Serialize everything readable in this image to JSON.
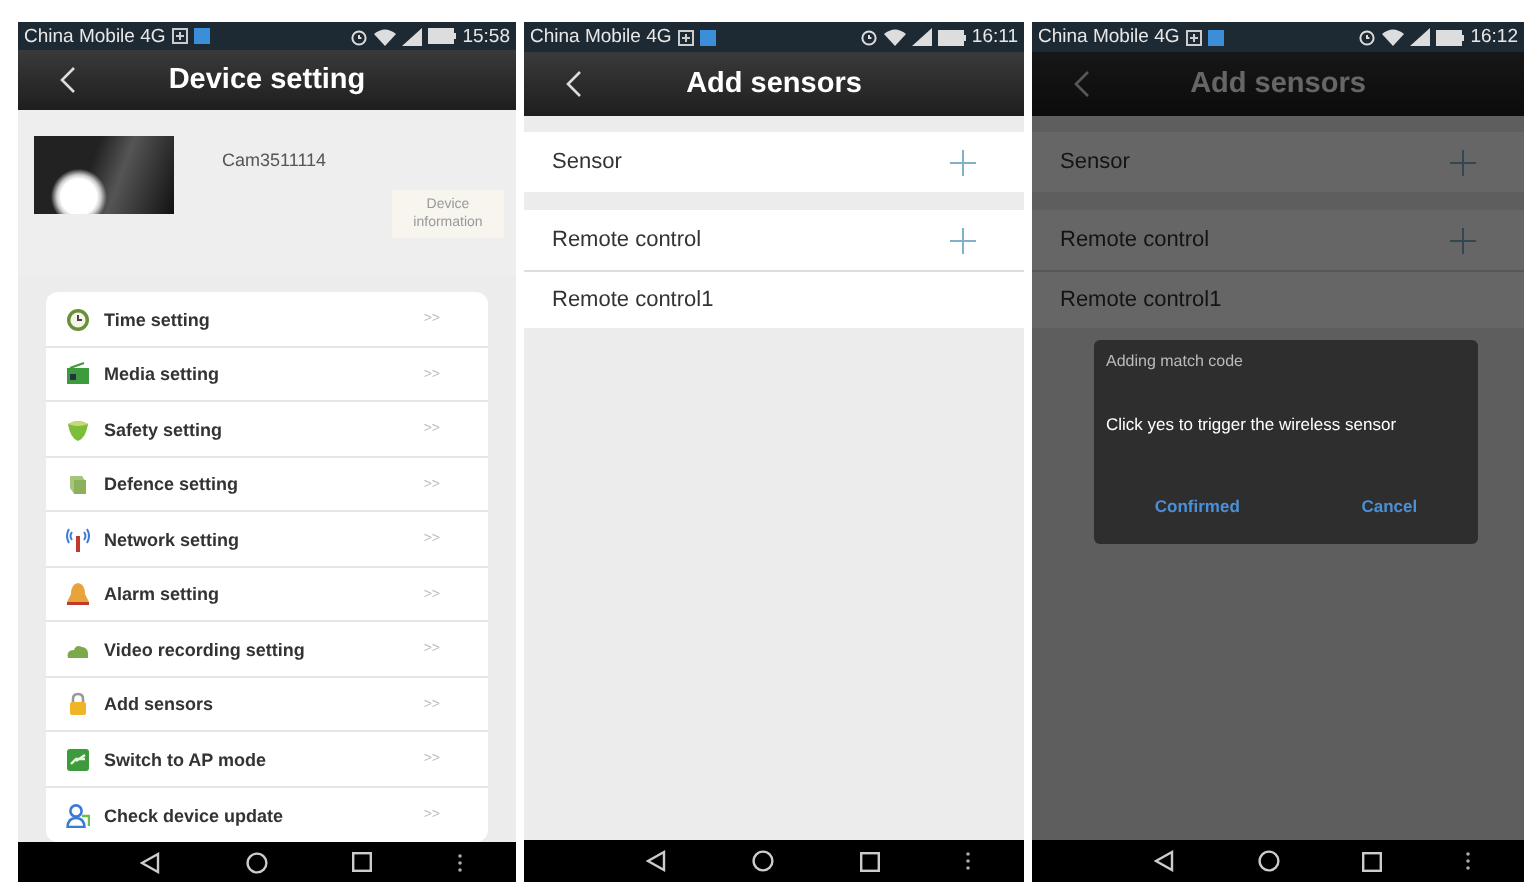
{
  "screens": [
    {
      "kind": "device_setting",
      "dimmed": false,
      "status_bar": {
        "carrier": "China Mobile 4G",
        "time": "15:58"
      },
      "header": {
        "title": "Device setting"
      },
      "device": {
        "name": "Cam3511114",
        "info_button": "Device information"
      },
      "menu": [
        {
          "label": "Time setting",
          "arrow": ">>"
        },
        {
          "label": "Media setting",
          "arrow": ">>"
        },
        {
          "label": "Safety setting",
          "arrow": ">>"
        },
        {
          "label": "Defence setting",
          "arrow": ">>"
        },
        {
          "label": "Network setting",
          "arrow": ">>"
        },
        {
          "label": "Alarm setting",
          "arrow": ">>"
        },
        {
          "label": "Video recording setting",
          "arrow": ">>"
        },
        {
          "label": "Add sensors",
          "arrow": ">>"
        },
        {
          "label": "Switch to AP mode",
          "arrow": ">>"
        },
        {
          "label": "Check device update",
          "arrow": ">>"
        }
      ]
    },
    {
      "kind": "sensors",
      "dimmed": false,
      "status_bar": {
        "carrier": "China Mobile 4G",
        "time": "16:11"
      },
      "header": {
        "title": "Add sensors"
      },
      "groups": [
        {
          "label": "Sensor"
        },
        {
          "label": "Remote control",
          "items": [
            "Remote control1"
          ]
        }
      ]
    },
    {
      "kind": "sensors",
      "dimmed": true,
      "status_bar": {
        "carrier": "China Mobile 4G",
        "time": "16:12"
      },
      "header": {
        "title": "Add sensors"
      },
      "groups": [
        {
          "label": "Sensor"
        },
        {
          "label": "Remote control",
          "items": [
            "Remote control1"
          ]
        }
      ],
      "dialog": {
        "title": "Adding match code",
        "message": "Click yes to trigger the wireless sensor",
        "buttons": [
          "Confirmed",
          "Cancel"
        ]
      }
    }
  ]
}
